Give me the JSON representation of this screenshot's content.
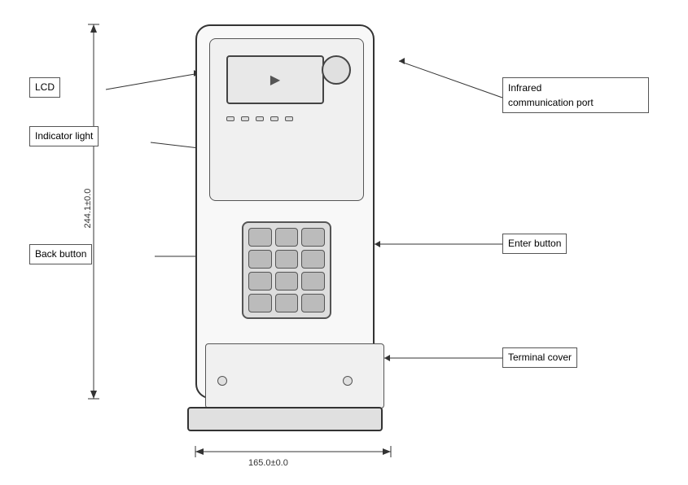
{
  "labels": {
    "lcd": "LCD",
    "indicator_light": "Indicator light",
    "infrared_port": "Infrared\ncommunication port",
    "infrared_line1": "Infrared",
    "infrared_line2": "communication port",
    "back_button": "Back button",
    "enter_button": "Enter button",
    "terminal_cover": "Terminal cover",
    "dim_width": "165.0±0.0",
    "dim_height": "244.1±0.0"
  },
  "colors": {
    "border": "#333333",
    "label_border": "#555555",
    "background": "#ffffff",
    "device_bg": "#f8f8f8"
  }
}
